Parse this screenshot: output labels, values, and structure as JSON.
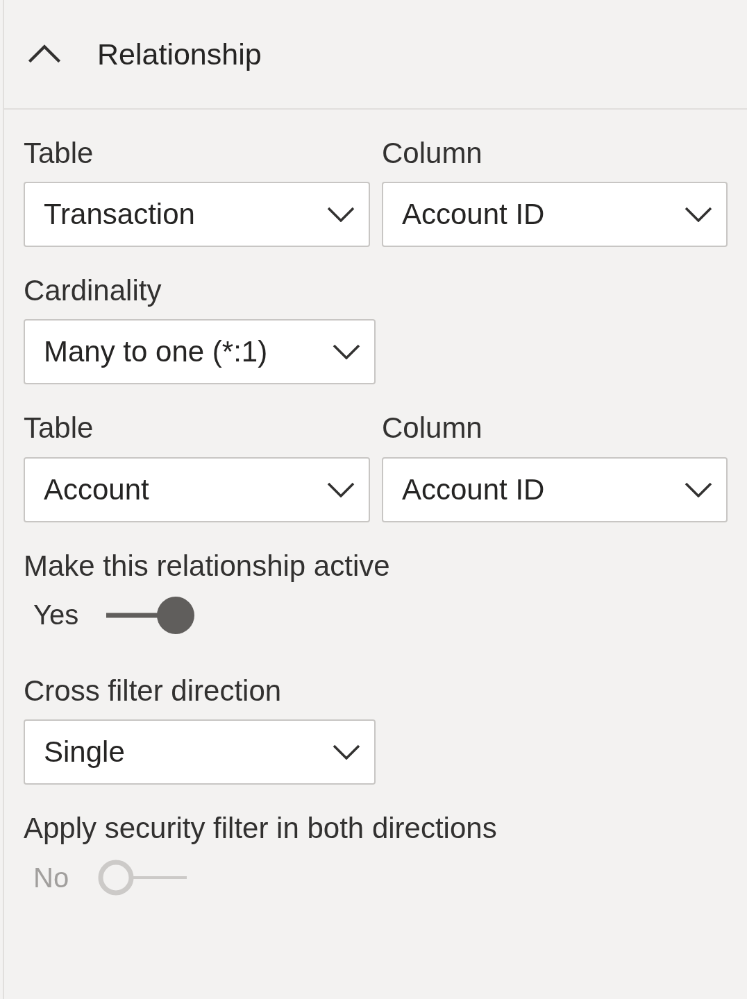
{
  "section": {
    "title": "Relationship",
    "expanded": true
  },
  "fields": [
    {
      "kind": "pair",
      "items": [
        {
          "label": "Table",
          "value": "Transaction"
        },
        {
          "label": "Column",
          "value": "Account ID"
        }
      ]
    },
    {
      "kind": "dropdown",
      "label": "Cardinality",
      "value": "Many to one (*:1)"
    },
    {
      "kind": "pair",
      "items": [
        {
          "label": "Table",
          "value": "Account"
        },
        {
          "label": "Column",
          "value": "Account ID"
        }
      ]
    },
    {
      "kind": "toggle",
      "label": "Make this relationship active",
      "state": "Yes",
      "on": true,
      "disabled": false
    },
    {
      "kind": "dropdown",
      "label": "Cross filter direction",
      "value": "Single"
    },
    {
      "kind": "toggle",
      "label": "Apply security filter in both directions",
      "state": "No",
      "on": false,
      "disabled": true
    }
  ]
}
